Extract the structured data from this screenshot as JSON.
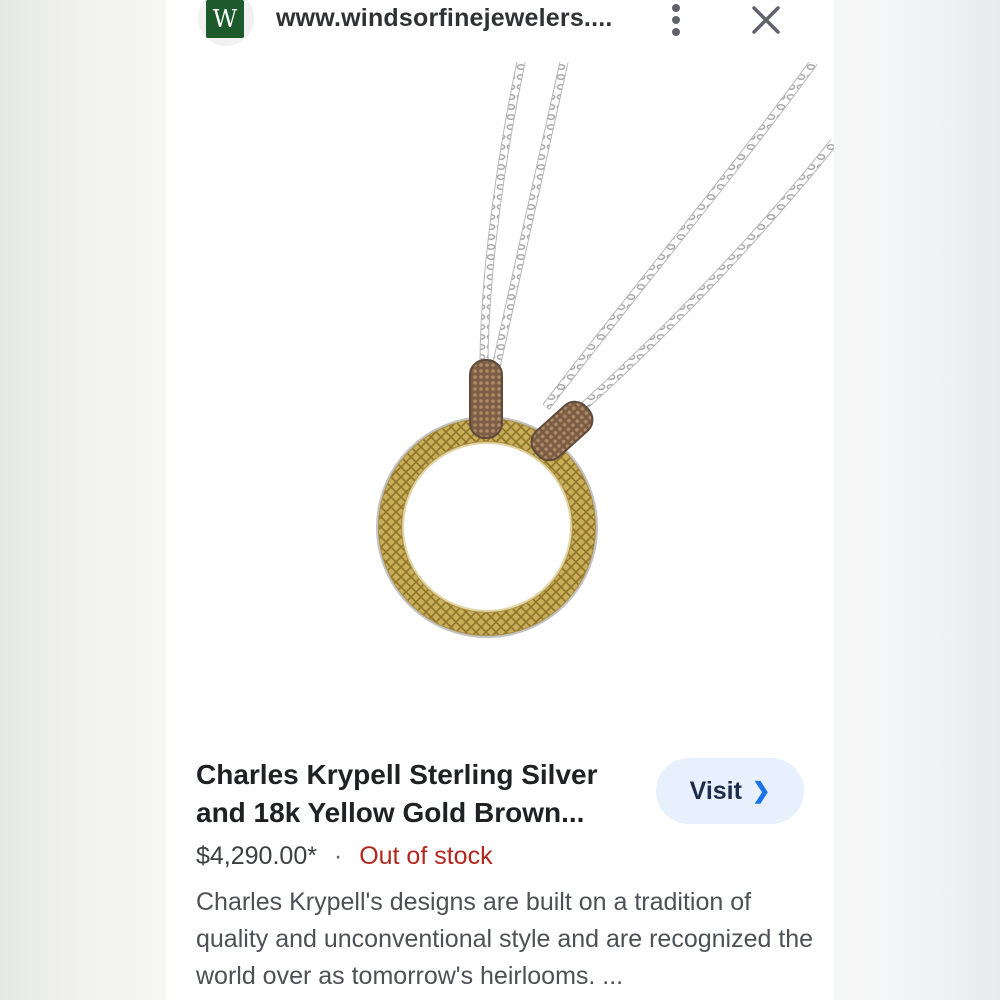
{
  "browser": {
    "url": "www.windsorfinejewelers....",
    "favicon_letter": "W",
    "favicon_color": "#1c5a2c",
    "menu_icon": "more-vert-icon",
    "close_icon": "close-icon"
  },
  "product": {
    "title": "Charles Krypell Sterling Silver and 18k Yellow Gold Brown...",
    "price": "$4,290.00*",
    "separator": "·",
    "stock_status": "Out of stock",
    "stock_color": "#b3261e",
    "description": "Charles Krypell's designs are built on a tradition of quality and unconventional style and are recognized the world over as tomorrow's heirlooms. ..."
  },
  "actions": {
    "visit_label": "Visit",
    "visit_icon": "chevron-right-icon"
  },
  "colors": {
    "accent": "#1a73e8",
    "visit_bg": "#e8f0fe"
  }
}
